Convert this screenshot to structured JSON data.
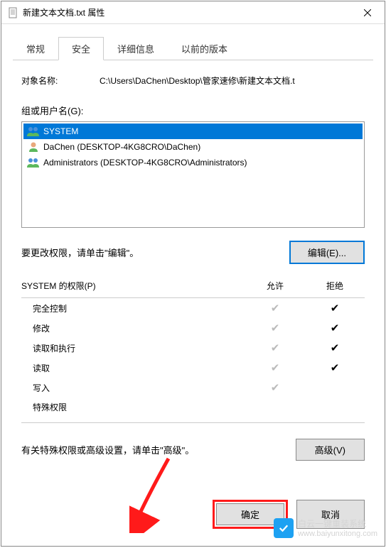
{
  "titlebar": {
    "title": "新建文本文档.txt 属性"
  },
  "tabs": {
    "general": "常规",
    "security": "安全",
    "details": "详细信息",
    "previous": "以前的版本"
  },
  "object": {
    "label": "对象名称:",
    "value": "C:\\Users\\DaChen\\Desktop\\管家速修\\新建文本文档.t"
  },
  "groups": {
    "label": "组或用户名(G):",
    "items": [
      {
        "name": "SYSTEM"
      },
      {
        "name": "DaChen (DESKTOP-4KG8CRO\\DaChen)"
      },
      {
        "name": "Administrators (DESKTOP-4KG8CRO\\Administrators)"
      }
    ]
  },
  "edit": {
    "text": "要更改权限，请单击\"编辑\"。",
    "button": "编辑(E)..."
  },
  "perms": {
    "header_for": "SYSTEM 的权限(P)",
    "col_allow": "允许",
    "col_deny": "拒绝",
    "rows": [
      {
        "name": "完全控制",
        "allow": "gray",
        "deny": "black"
      },
      {
        "name": "修改",
        "allow": "gray",
        "deny": "black"
      },
      {
        "name": "读取和执行",
        "allow": "gray",
        "deny": "black"
      },
      {
        "name": "读取",
        "allow": "gray",
        "deny": "black"
      },
      {
        "name": "写入",
        "allow": "gray",
        "deny": ""
      },
      {
        "name": "特殊权限",
        "allow": "",
        "deny": ""
      }
    ]
  },
  "advanced": {
    "text": "有关特殊权限或高级设置，请单击\"高级\"。",
    "button": "高级(V)"
  },
  "buttons": {
    "ok": "确定",
    "cancel": "取消"
  },
  "watermark": {
    "text": "白云一键重装系统",
    "url": "www.baiyunxitong.com"
  }
}
